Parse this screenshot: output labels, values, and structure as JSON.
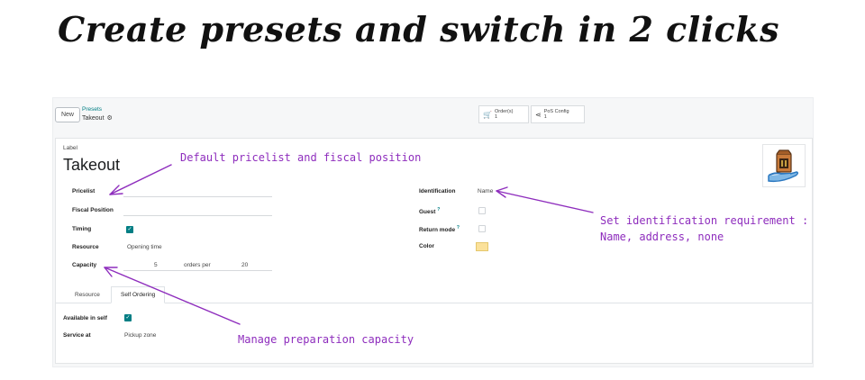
{
  "headline": "Create presets and switch in 2 clicks",
  "control_panel": {
    "new_label": "New",
    "breadcrumb_parent": "Presets",
    "breadcrumb_current": "Takeout",
    "orders_label": "Order(s)",
    "orders_count": "1",
    "posconfig_label": "PoS Config",
    "posconfig_count": "1"
  },
  "form": {
    "label_caption": "Label",
    "title": "Takeout",
    "left_fields": {
      "pricelist": "Pricelist",
      "fiscal_position": "Fiscal Position",
      "timing": "Timing",
      "resource": "Resource",
      "resource_value": "Opening time",
      "capacity": "Capacity",
      "capacity_value": "5",
      "orders_per": "orders per",
      "per_value": "20"
    },
    "right_fields": {
      "identification": "Identification",
      "identification_value": "Name",
      "guest": "Guest",
      "return_mode": "Return mode",
      "help_mark": "?",
      "color": "Color",
      "color_value": "#fbe19a"
    },
    "tabs": [
      "Resource",
      "Self Ordering"
    ],
    "self_ordering": {
      "available_label": "Available in self",
      "service_label": "Service at",
      "service_value": "Pickup zone"
    }
  },
  "annotations": {
    "pricelist_note": "Default pricelist and fiscal position",
    "identification_note_line1": "Set identification requirement :",
    "identification_note_line2": "Name, address, none",
    "capacity_note": "Manage preparation capacity",
    "color": "#8e2dbd"
  },
  "colors": {
    "accent": "#017e84"
  }
}
